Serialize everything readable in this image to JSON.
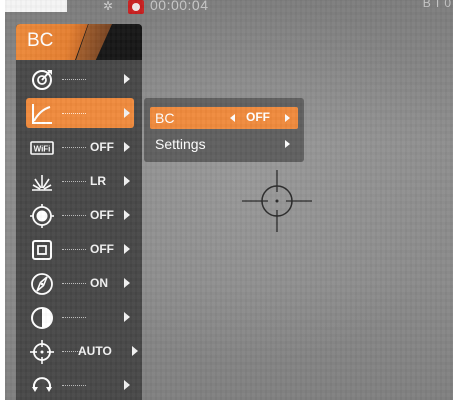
{
  "status_bar": {
    "timer": "00:00:04",
    "right_text": "B T 0"
  },
  "menu": {
    "title": "BC",
    "items": [
      {
        "icon": "target-dial-icon",
        "value": ""
      },
      {
        "icon": "ballistic-curve-icon",
        "value": "",
        "selected": true
      },
      {
        "icon": "wifi-icon",
        "value": "OFF"
      },
      {
        "icon": "recoil-burst-icon",
        "value": "LR"
      },
      {
        "icon": "hotspot-tracking-icon",
        "value": "OFF"
      },
      {
        "icon": "frame-square-icon",
        "value": "OFF"
      },
      {
        "icon": "compass-icon",
        "value": "ON"
      },
      {
        "icon": "contrast-icon",
        "value": ""
      },
      {
        "icon": "crosshair-icon",
        "value": "AUTO"
      },
      {
        "icon": "rotate-icon",
        "value": ""
      }
    ]
  },
  "submenu": {
    "rows": [
      {
        "label": "BC",
        "value": "OFF",
        "selected": true
      },
      {
        "label": "Settings",
        "value": ""
      }
    ]
  },
  "colors": {
    "accent": "#f08a3c",
    "menu_bg": "#474747",
    "submenu_bg": "#5f5f5f",
    "header_bg": "#151515"
  }
}
